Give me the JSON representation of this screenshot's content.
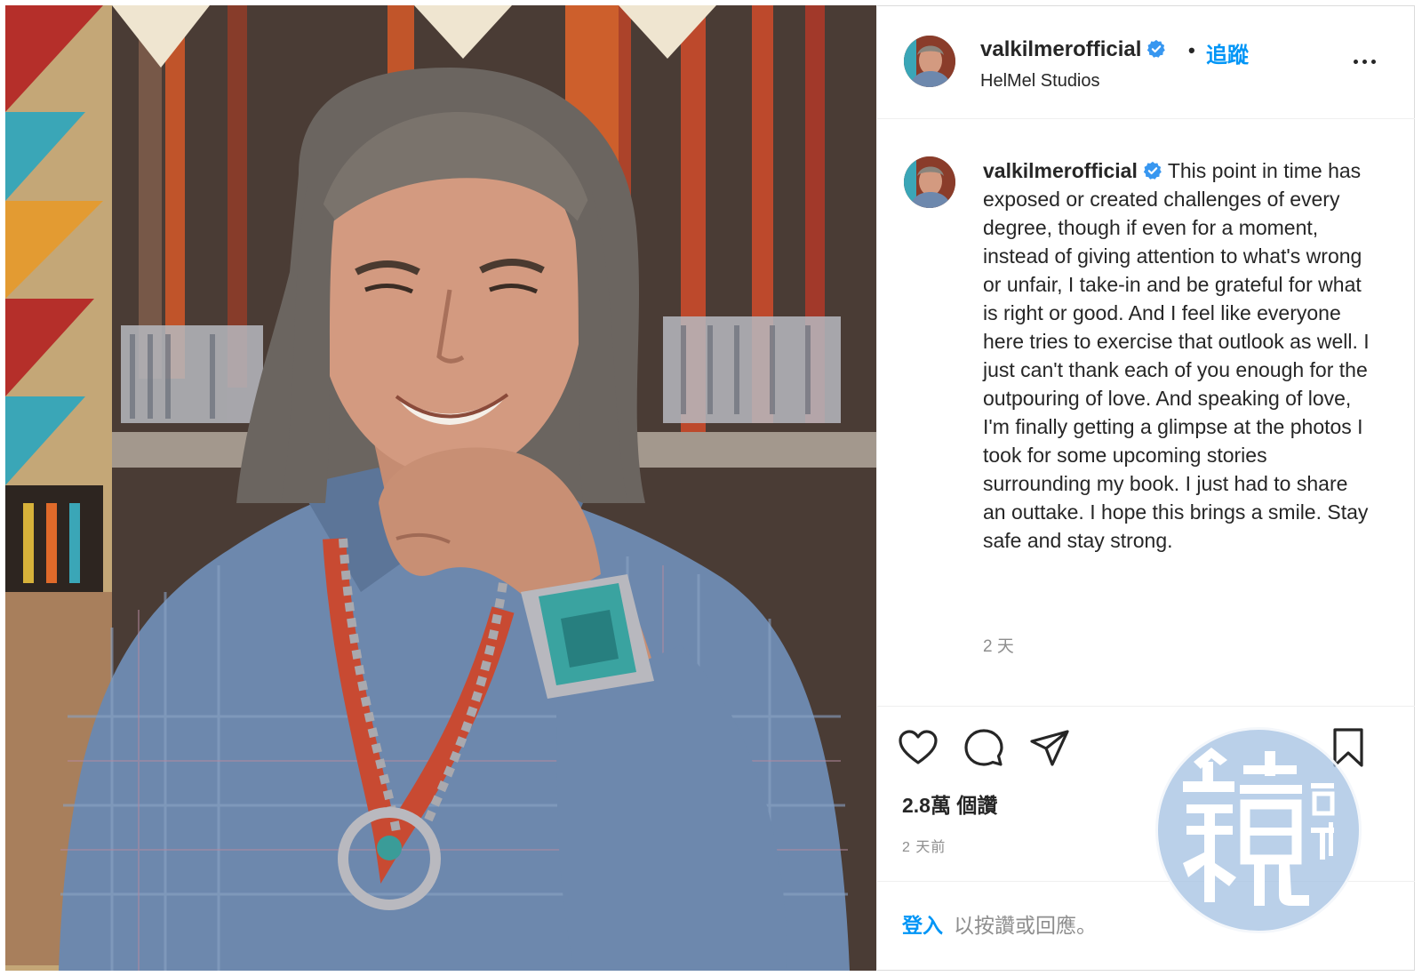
{
  "post": {
    "username": "valkilmerofficial",
    "separator": "•",
    "follow_label": "追蹤",
    "location": "HelMel Studios",
    "caption": "This point in time has exposed or created challenges of every degree, though if even for a moment, instead of giving attention to what's wrong or unfair, I take-in and be grateful for what is right or good. And I feel like everyone here tries to exercise that outlook as well. I just can't thank each of you enough for the outpouring of love. And speaking of love, I'm finally getting a glimpse at the photos I took for some upcoming stories surrounding my book. I just had to share an outtake. I hope this brings a smile. Stay safe and stay strong.",
    "caption_age": "2 天",
    "likes": "2.8萬 個讚",
    "post_date": "2 天前",
    "login_link": "登入",
    "login_suffix": "以按讚或回應。"
  },
  "icons": {
    "like": "heart-icon",
    "comment": "comment-icon",
    "share": "paper-plane-icon",
    "save": "bookmark-icon",
    "more": "more-horizontal-icon",
    "verified": "verified-badge-icon"
  },
  "colors": {
    "link_blue": "#0095f6",
    "verified_blue": "#3897f0",
    "muted_text": "#8e8e8e",
    "border": "#efefef"
  }
}
